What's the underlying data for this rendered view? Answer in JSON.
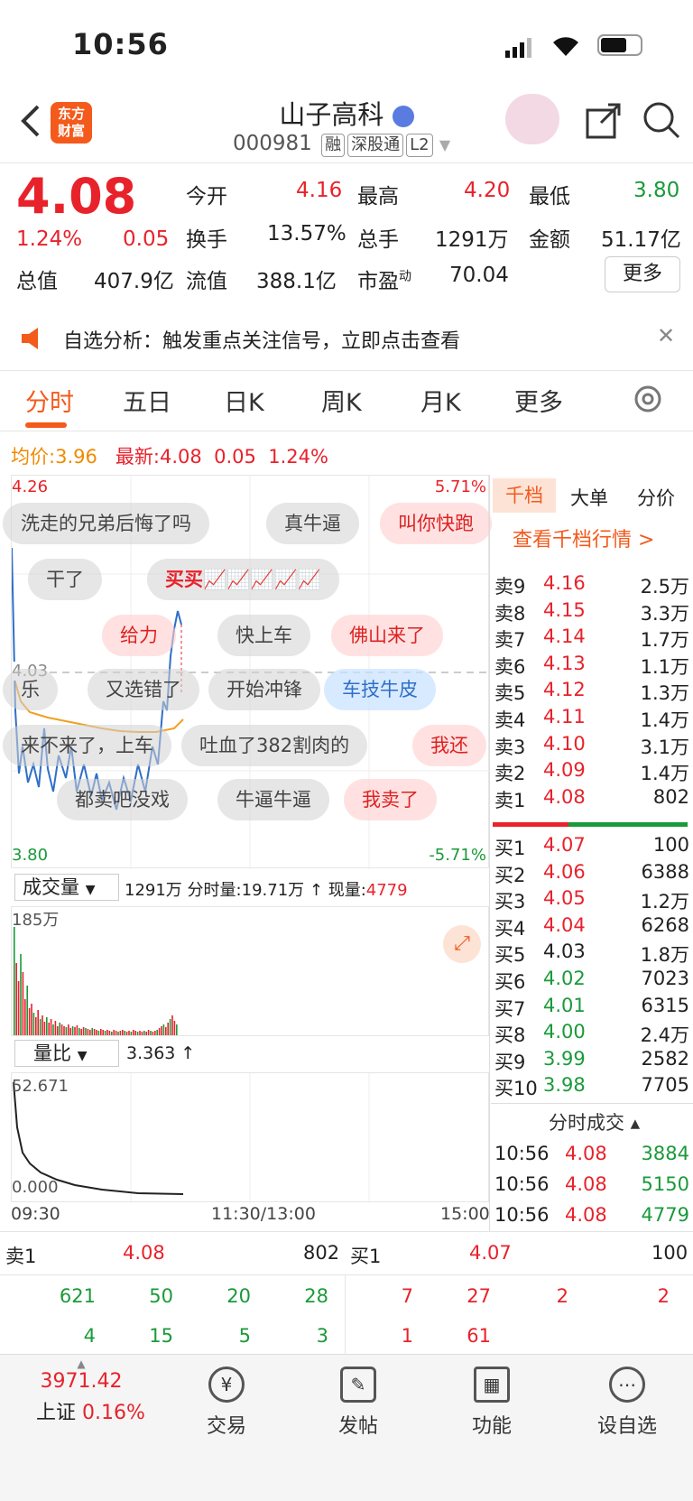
{
  "status": {
    "time": "10:56"
  },
  "header": {
    "logo_line1": "东方",
    "logo_line2": "财富",
    "title": "山子高科",
    "code": "000981",
    "tags": [
      "融",
      "深股通",
      "L2"
    ]
  },
  "quote": {
    "price": "4.08",
    "change_pct": "1.24%",
    "change": "0.05",
    "open_label": "今开",
    "open": "4.16",
    "high_label": "最高",
    "high": "4.20",
    "low_label": "最低",
    "low": "3.80",
    "turnover_label": "换手",
    "turnover": "13.57%",
    "volume_label": "总手",
    "volume": "1291万",
    "amount_label": "金额",
    "amount": "51.17亿",
    "mktcap_label": "总值",
    "mktcap": "407.9亿",
    "float_label": "流值",
    "float": "388.1亿",
    "pe_label": "市盈",
    "pe_sup": "动",
    "pe": "70.04",
    "more_label": "更多"
  },
  "notice": {
    "text": "自选分析：触发重点关注信号，立即点击查看"
  },
  "tabs": [
    "分时",
    "五日",
    "日K",
    "周K",
    "月K",
    "更多"
  ],
  "info_line": {
    "avg_label": "均价:",
    "avg": "3.96",
    "last_label": "最新:",
    "last": "4.08",
    "chg": "0.05",
    "pct": "1.24%"
  },
  "chart": {
    "y_top": "4.26",
    "y_mid": "4.03",
    "y_bottom": "3.80",
    "pct_top": "5.71%",
    "pct_bottom": "-5.71%",
    "times": [
      "09:30",
      "11:30/13:00",
      "15:00"
    ]
  },
  "danmu": [
    "洗走的兄弟后悔了吗",
    "真牛逼",
    "叫你快跑",
    "干了",
    "买买📈📈📈📈📈",
    "给力",
    "快上车",
    "佛山来了",
    "乐",
    "又选错了",
    "开始冲锋",
    "车技牛皮",
    "来不来了，上车",
    "吐血了382割肉的",
    "我还",
    "都卖吧没戏",
    "牛逼牛逼",
    "我卖了"
  ],
  "volume_bar": {
    "label": "成交量",
    "total": "1291万",
    "fenshi_label": "分时量:",
    "fenshi": "19.71万 ↑",
    "now_label": "现量:",
    "now": "4779",
    "max": "185万"
  },
  "ratio_bar": {
    "label": "量比",
    "value": "3.363 ↑",
    "max": "52.671",
    "min": "0.000"
  },
  "orderbook": {
    "tabs": [
      "千档",
      "大单",
      "分价"
    ],
    "link": "查看千档行情 >",
    "sells": [
      {
        "l": "卖9",
        "p": "4.16",
        "v": "2.5万"
      },
      {
        "l": "卖8",
        "p": "4.15",
        "v": "3.3万"
      },
      {
        "l": "卖7",
        "p": "4.14",
        "v": "1.7万"
      },
      {
        "l": "卖6",
        "p": "4.13",
        "v": "1.1万"
      },
      {
        "l": "卖5",
        "p": "4.12",
        "v": "1.3万"
      },
      {
        "l": "卖4",
        "p": "4.11",
        "v": "1.4万"
      },
      {
        "l": "卖3",
        "p": "4.10",
        "v": "3.1万"
      },
      {
        "l": "卖2",
        "p": "4.09",
        "v": "1.4万"
      },
      {
        "l": "卖1",
        "p": "4.08",
        "v": "802"
      }
    ],
    "buys": [
      {
        "l": "买1",
        "p": "4.07",
        "v": "100"
      },
      {
        "l": "买2",
        "p": "4.06",
        "v": "6388"
      },
      {
        "l": "买3",
        "p": "4.05",
        "v": "1.2万"
      },
      {
        "l": "买4",
        "p": "4.04",
        "v": "6268"
      },
      {
        "l": "买5",
        "p": "4.03",
        "v": "1.8万"
      },
      {
        "l": "买6",
        "p": "4.02",
        "v": "7023"
      },
      {
        "l": "买7",
        "p": "4.01",
        "v": "6315"
      },
      {
        "l": "买8",
        "p": "4.00",
        "v": "2.4万"
      },
      {
        "l": "买9",
        "p": "3.99",
        "v": "2582"
      },
      {
        "l": "买10",
        "p": "3.98",
        "v": "7705"
      }
    ],
    "ticks_label": "分时成交",
    "ticks": [
      {
        "t": "10:56",
        "p": "4.08",
        "v": "3884"
      },
      {
        "t": "10:56",
        "p": "4.08",
        "v": "5150"
      },
      {
        "t": "10:56",
        "p": "4.08",
        "v": "4779"
      }
    ]
  },
  "level1": {
    "sell_label": "卖1",
    "sell_price": "4.08",
    "sell_vol": "802",
    "buy_label": "买1",
    "buy_price": "4.07",
    "buy_vol": "100",
    "sell_row1": [
      "621",
      "50",
      "20",
      "28"
    ],
    "sell_row2": [
      "4",
      "15",
      "5",
      "3"
    ],
    "buy_row1": [
      "7",
      "27",
      "2",
      "2"
    ],
    "buy_row2": [
      "1",
      "61"
    ]
  },
  "bottom": {
    "index": "3971.42",
    "index_name": "上证",
    "index_pct": "0.16%",
    "nav": [
      "交易",
      "发帖",
      "功能",
      "设自选"
    ]
  },
  "colors": {
    "red": "#e8222b",
    "green": "#1a9a3a",
    "accent": "#f35a1c",
    "avg_line": "#f0a020",
    "price_line": "#2f6fc8"
  }
}
